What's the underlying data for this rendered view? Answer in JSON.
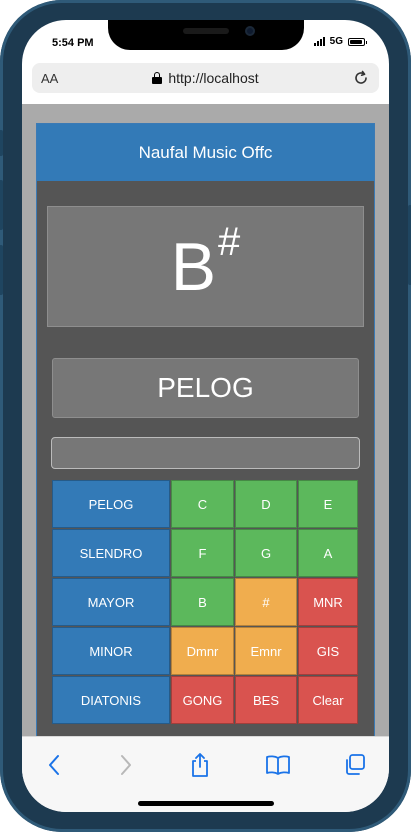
{
  "status_bar": {
    "time": "5:54 PM",
    "network": "5G",
    "battery_level": 0.9
  },
  "browser": {
    "text_size_label": "AA",
    "url": "http://localhost"
  },
  "app": {
    "title": "Naufal Music Offc",
    "note": {
      "letter": "B",
      "accidental": "#"
    },
    "mode": "PELOG",
    "input_value": ""
  },
  "keypad": [
    [
      {
        "label": "PELOG",
        "color": "blue"
      },
      {
        "label": "C",
        "color": "green"
      },
      {
        "label": "D",
        "color": "green"
      },
      {
        "label": "E",
        "color": "green"
      }
    ],
    [
      {
        "label": "SLENDRO",
        "color": "blue"
      },
      {
        "label": "F",
        "color": "green"
      },
      {
        "label": "G",
        "color": "green"
      },
      {
        "label": "A",
        "color": "green"
      }
    ],
    [
      {
        "label": "MAYOR",
        "color": "blue"
      },
      {
        "label": "B",
        "color": "green"
      },
      {
        "label": "#",
        "color": "orange"
      },
      {
        "label": "MNR",
        "color": "red"
      }
    ],
    [
      {
        "label": "MINOR",
        "color": "blue"
      },
      {
        "label": "Dmnr",
        "color": "orange"
      },
      {
        "label": "Emnr",
        "color": "orange"
      },
      {
        "label": "GIS",
        "color": "red"
      }
    ],
    [
      {
        "label": "DIATONIS",
        "color": "blue"
      },
      {
        "label": "GONG",
        "color": "red"
      },
      {
        "label": "BES",
        "color": "red"
      },
      {
        "label": "Clear",
        "color": "red"
      }
    ]
  ],
  "colors": {
    "blue": "#337ab7",
    "green": "#5cb85c",
    "orange": "#f0ad4e",
    "red": "#d9534f",
    "ios_tint": "#1a73e8"
  },
  "toolbar_icons": [
    "back-icon",
    "forward-icon",
    "share-icon",
    "bookmarks-icon",
    "tabs-icon"
  ]
}
